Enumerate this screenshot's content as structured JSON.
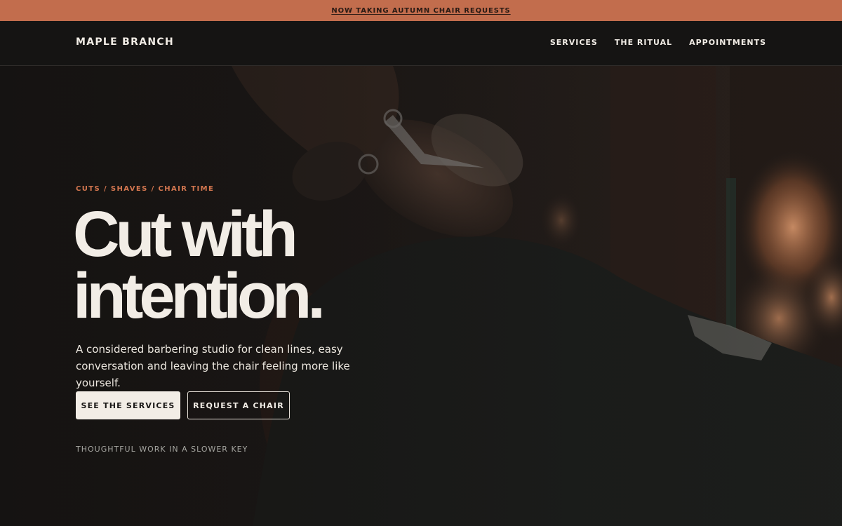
{
  "promo": {
    "text": "NOW TAKING AUTUMN CHAIR REQUESTS"
  },
  "nav": {
    "brand": "MAPLE BRANCH",
    "links": [
      "SERVICES",
      "THE RITUAL",
      "APPOINTMENTS"
    ]
  },
  "hero": {
    "eyebrow": "CUTS / SHAVES / CHAIR TIME",
    "headline_line1": "Cut with",
    "headline_line2": "intention.",
    "lede": "A considered barbering studio for clean lines, easy conversation and leaving the chair feeling more like yourself.",
    "primary_button": "SEE THE SERVICES",
    "secondary_button": "REQUEST A CHAIR",
    "tagline": "THOUGHTFUL WORK IN A SLOWER KEY"
  },
  "colors": {
    "accent": "#c26d4d",
    "eyebrow": "#d3764f",
    "background": "#151413",
    "cream": "#f2ede6"
  }
}
